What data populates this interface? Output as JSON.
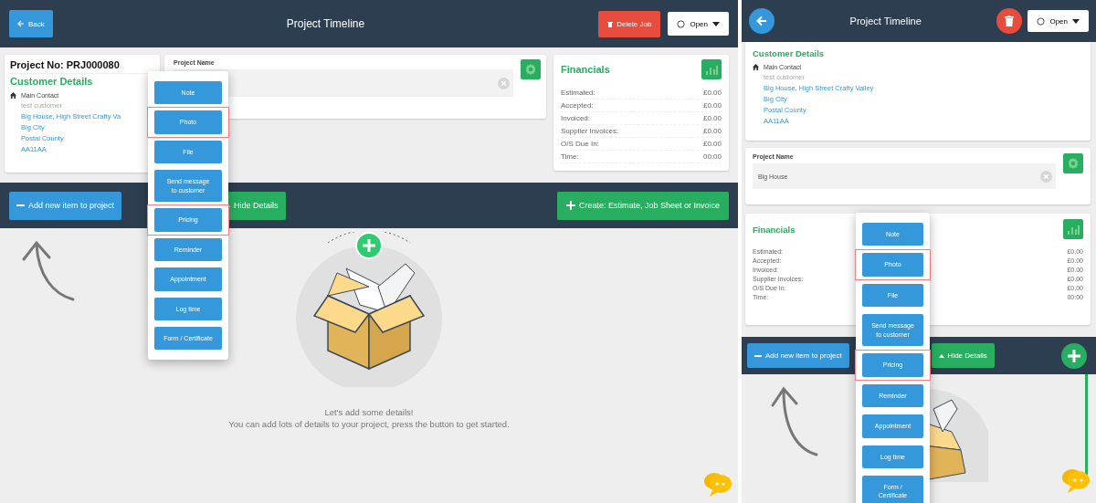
{
  "desktop": {
    "header": {
      "back": "Back",
      "title": "Project Timeline",
      "delete": "Delete Job",
      "status": "Open"
    },
    "customer": {
      "project_no": "Project No: PRJ000080",
      "heading": "Customer Details",
      "contact_label": "Main Contact",
      "contact_name": "test customer",
      "address": [
        "Big House, High Street Crafty Va",
        "Big City",
        "Postal County",
        "AA11AA"
      ]
    },
    "project_name": {
      "label": "Project Name"
    },
    "financials": {
      "title": "Financials",
      "rows": [
        {
          "label": "Estimated:",
          "value": "£0.00"
        },
        {
          "label": "Accepted:",
          "value": "£0.00"
        },
        {
          "label": "Invoiced:",
          "value": "£0.00"
        },
        {
          "label": "Supplier Invoices:",
          "value": "£0.00"
        },
        {
          "label": "O/S Due In:",
          "value": "£0.00"
        },
        {
          "label": "Time:",
          "value": "00:00"
        }
      ]
    },
    "toolbar": {
      "add": "Add new item to project",
      "hide": "Hide Details",
      "create": "Create: Estimate, Job Sheet or Invoice"
    },
    "menu": [
      {
        "label": "Note",
        "highlighted": false
      },
      {
        "label": "Photo",
        "highlighted": true
      },
      {
        "label": "File",
        "highlighted": false
      },
      {
        "label": "Send message to customer",
        "highlighted": false
      },
      {
        "label": "Pricing",
        "highlighted": true
      },
      {
        "label": "Reminder",
        "highlighted": false
      },
      {
        "label": "Appointment",
        "highlighted": false
      },
      {
        "label": "Log time",
        "highlighted": false
      },
      {
        "label": "Form / Certificate",
        "highlighted": false
      }
    ],
    "empty_state": {
      "title": "Let's add some details!",
      "text": "You can add lots of details to your project, press the button to get started."
    }
  },
  "mobile": {
    "header": {
      "title": "Project Timeline",
      "status": "Open"
    },
    "customer": {
      "heading": "Customer Details",
      "contact_label": "Main Contact",
      "contact_name": "test customer",
      "address": [
        "Big House, High Street Crafty Valley",
        "Big City",
        "Postal County",
        "AA11AA"
      ]
    },
    "project_name": {
      "label": "Project Name",
      "value": "Big House"
    },
    "financials": {
      "title": "Financials",
      "rows": [
        {
          "label": "Estimated:",
          "value": "£0.00"
        },
        {
          "label": "Accepted:",
          "value": "£0.00"
        },
        {
          "label": "Invoiced:",
          "value": "£0.00"
        },
        {
          "label": "Supplier Invoices:",
          "value": "£0.00"
        },
        {
          "label": "O/S Due In:",
          "value": "£0.00"
        },
        {
          "label": "Time:",
          "value": "00:00"
        }
      ]
    },
    "toolbar": {
      "add": "Add new item to project",
      "hide": "Hide Details"
    },
    "menu": [
      {
        "label": "Note",
        "highlighted": false
      },
      {
        "label": "Photo",
        "highlighted": true
      },
      {
        "label": "File",
        "highlighted": false
      },
      {
        "label": "Send message to customer",
        "highlighted": false
      },
      {
        "label": "Pricing",
        "highlighted": true
      },
      {
        "label": "Reminder",
        "highlighted": false
      },
      {
        "label": "Appointment",
        "highlighted": false
      },
      {
        "label": "Log time",
        "highlighted": false
      },
      {
        "label": "Form / Certificate",
        "highlighted": false
      }
    ]
  }
}
